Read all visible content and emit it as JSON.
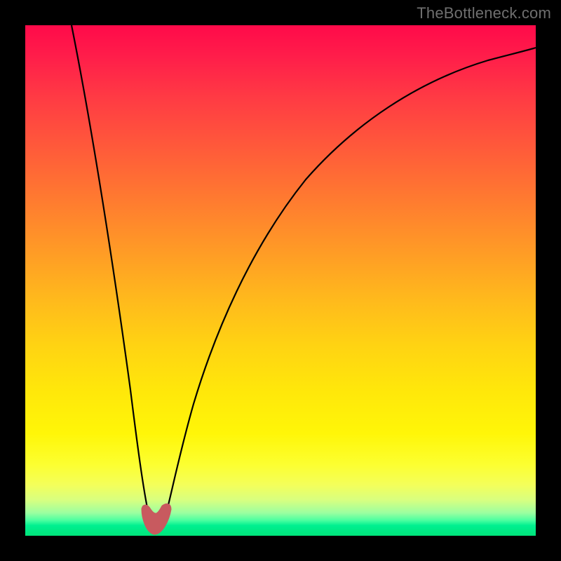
{
  "watermark": "TheBottleneck.com",
  "chart_data": {
    "type": "line",
    "title": "",
    "xlabel": "",
    "ylabel": "",
    "xlim": [
      0,
      100
    ],
    "ylim": [
      0,
      100
    ],
    "grid": false,
    "series": [
      {
        "name": "bottleneck-curve",
        "x": [
          9,
          12,
          15,
          18,
          20,
          22,
          23,
          24,
          25,
          26,
          27,
          28,
          30,
          33,
          38,
          45,
          55,
          65,
          75,
          85,
          95,
          100
        ],
        "values": [
          100,
          82,
          64,
          46,
          33,
          19,
          10,
          4,
          2,
          2,
          4,
          10,
          23,
          38,
          54,
          68,
          80,
          87,
          91,
          94,
          96,
          97
        ]
      }
    ],
    "marker": {
      "name": "optimal-region",
      "x_center": 25,
      "width": 4,
      "color": "#c85a5f"
    }
  }
}
